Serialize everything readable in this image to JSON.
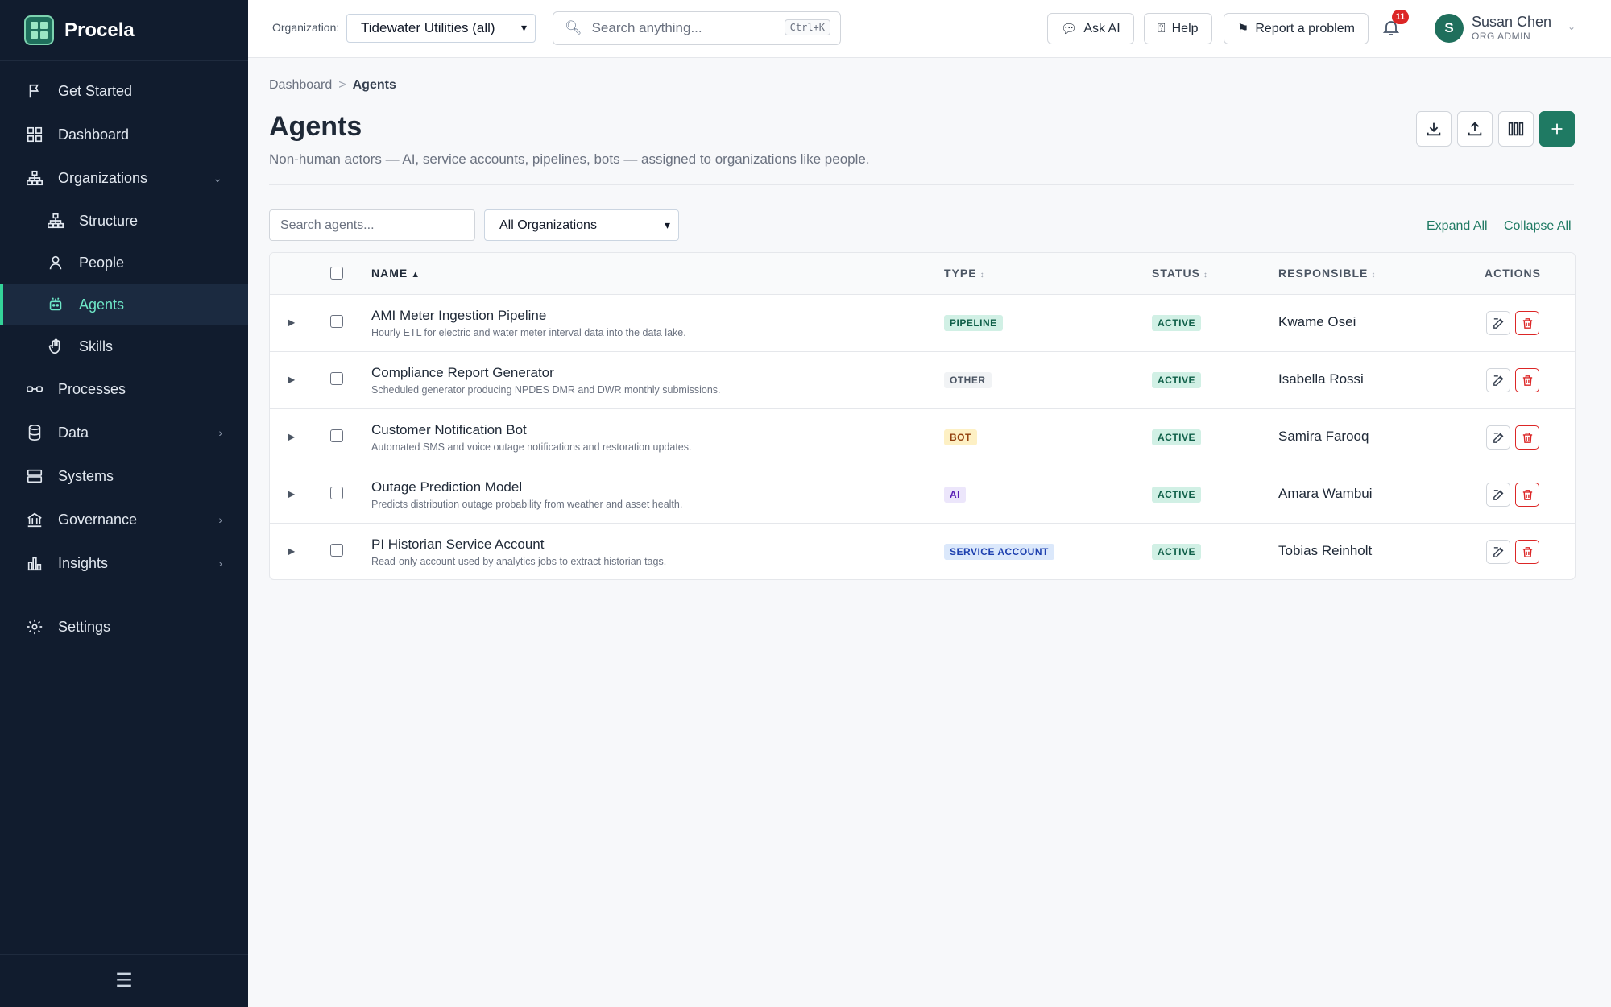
{
  "app": {
    "name": "Procela"
  },
  "sidebar": {
    "items": [
      {
        "label": "Get Started"
      },
      {
        "label": "Dashboard"
      },
      {
        "label": "Organizations",
        "caret": "⌄"
      },
      {
        "label": "Structure"
      },
      {
        "label": "People"
      },
      {
        "label": "Agents"
      },
      {
        "label": "Skills"
      },
      {
        "label": "Processes"
      },
      {
        "label": "Data",
        "caret": "›"
      },
      {
        "label": "Systems"
      },
      {
        "label": "Governance",
        "caret": "›"
      },
      {
        "label": "Insights",
        "caret": "›"
      },
      {
        "label": "Settings"
      }
    ],
    "footer_icon": "☰"
  },
  "topbar": {
    "org_label": "Organization:",
    "org_value": "Tidewater Utilities (all)",
    "search_placeholder": "Search anything...",
    "search_shortcut": "Ctrl+K",
    "ask_ai": "Ask AI",
    "help": "Help",
    "report": "Report a problem",
    "notification_count": "11",
    "user_initial": "S",
    "user_name": "Susan Chen",
    "user_role": "ORG ADMIN"
  },
  "page": {
    "breadcrumb_root": "Dashboard",
    "breadcrumb_sep": ">",
    "breadcrumb_current": "Agents",
    "title": "Agents",
    "subtitle": "Non-human actors — AI, service accounts, pipelines, bots — assigned to organizations like people."
  },
  "filters": {
    "search_placeholder": "Search agents...",
    "org_filter": "All Organizations",
    "expand_all": "Expand All",
    "collapse_all": "Collapse All"
  },
  "table": {
    "columns": {
      "name": "NAME",
      "type": "TYPE",
      "status": "STATUS",
      "responsible": "RESPONSIBLE",
      "actions": "ACTIONS"
    },
    "rows": [
      {
        "name": "AMI Meter Ingestion Pipeline",
        "desc": "Hourly ETL for electric and water meter interval data into the data lake.",
        "type": "PIPELINE",
        "status": "ACTIVE",
        "responsible": "Kwame Osei"
      },
      {
        "name": "Compliance Report Generator",
        "desc": "Scheduled generator producing NPDES DMR and DWR monthly submissions.",
        "type": "OTHER",
        "status": "ACTIVE",
        "responsible": "Isabella Rossi"
      },
      {
        "name": "Customer Notification Bot",
        "desc": "Automated SMS and voice outage notifications and restoration updates.",
        "type": "BOT",
        "status": "ACTIVE",
        "responsible": "Samira Farooq"
      },
      {
        "name": "Outage Prediction Model",
        "desc": "Predicts distribution outage probability from weather and asset health.",
        "type": "AI",
        "status": "ACTIVE",
        "responsible": "Amara Wambui"
      },
      {
        "name": "PI Historian Service Account",
        "desc": "Read-only account used by analytics jobs to extract historian tags.",
        "type": "SERVICE ACCOUNT",
        "status": "ACTIVE",
        "responsible": "Tobias Reinholt"
      }
    ]
  },
  "colors": {
    "sidebar_bg": "#111c2e",
    "accent": "#1f7a63",
    "active_text": "#6ee7c7",
    "pipeline": "#d1f0e5",
    "other": "#f1f3f5",
    "bot": "#fdf0c4",
    "ai": "#ece6fb",
    "service_account": "#dbe8fb",
    "danger": "#dc2626"
  }
}
